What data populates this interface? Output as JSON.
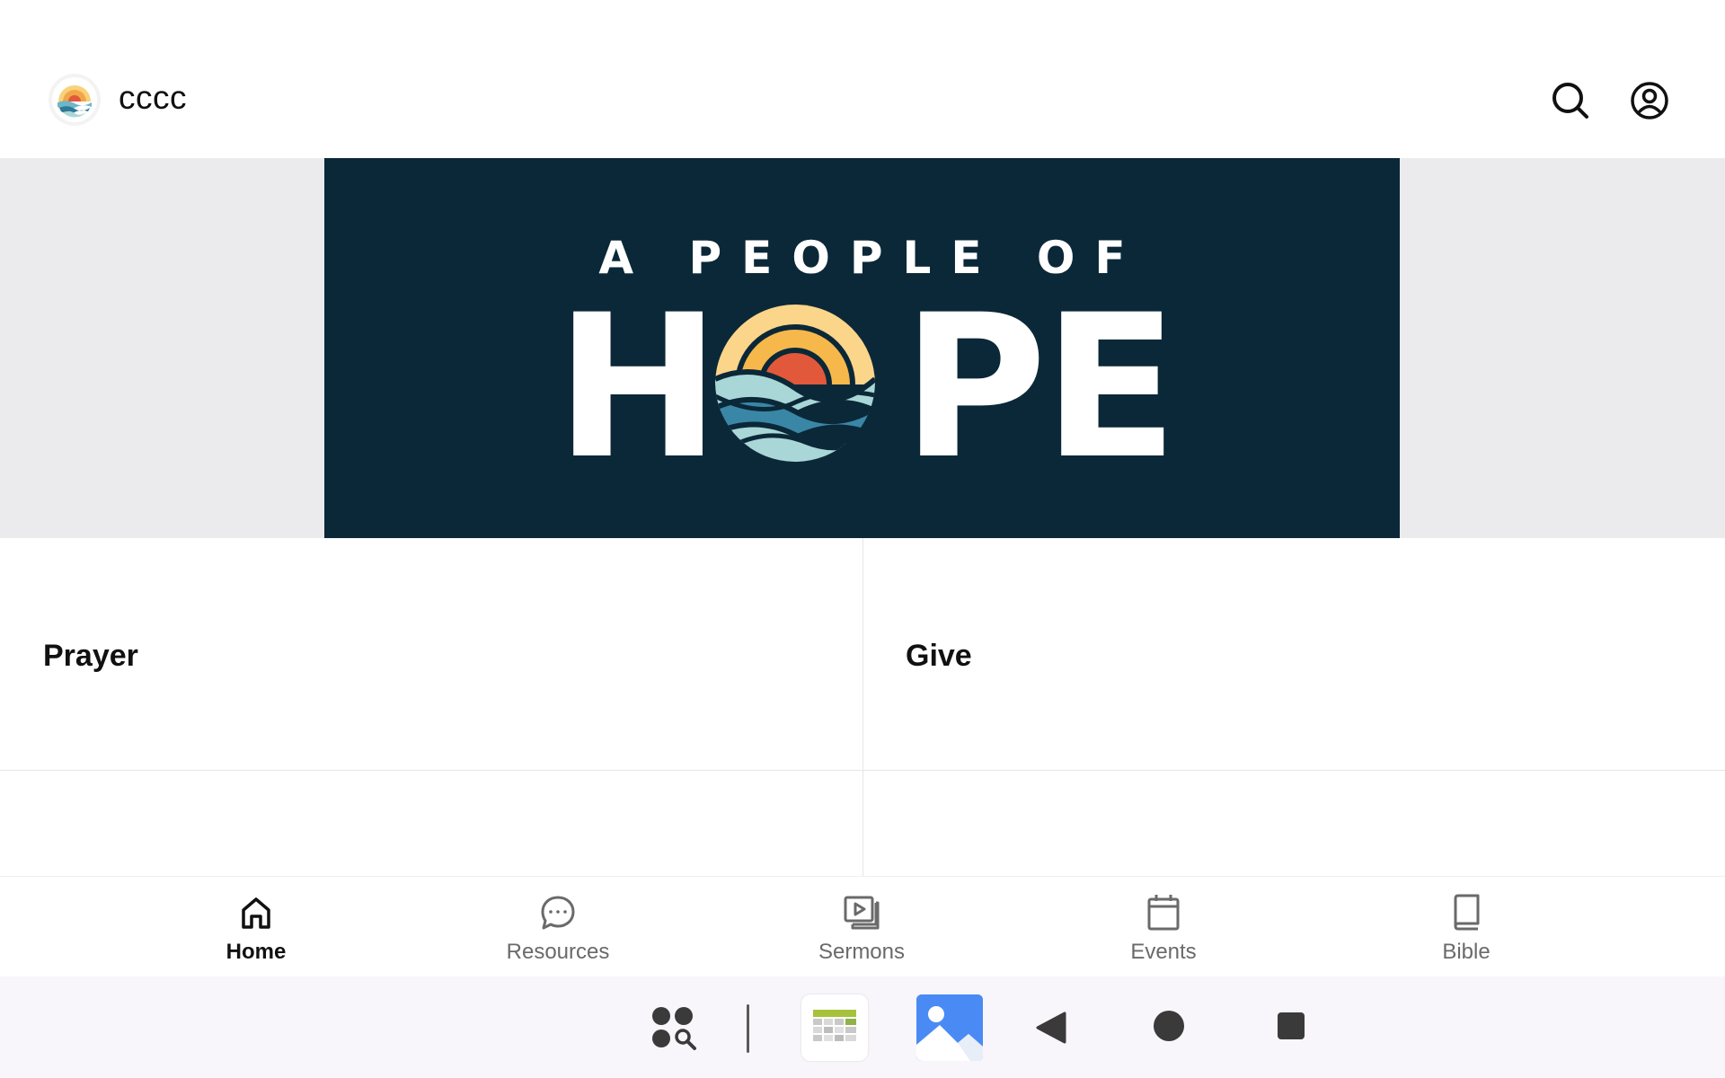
{
  "app": {
    "title": "cccc",
    "logo_icon": "sunset-waves-logo-icon"
  },
  "top_actions": {
    "search_icon": "search-icon",
    "account_icon": "account-circle-icon"
  },
  "hero": {
    "line1": "A PEOPLE OF",
    "word_letters": [
      "H",
      "P",
      "E"
    ],
    "o_icon": "sunset-waves-emblem",
    "background": "#0b2838"
  },
  "tiles": [
    {
      "label": "Prayer"
    },
    {
      "label": "Give"
    }
  ],
  "bottom_nav": {
    "items": [
      {
        "label": "Home",
        "icon": "home-icon",
        "active": true
      },
      {
        "label": "Resources",
        "icon": "chat-bubble-icon",
        "active": false
      },
      {
        "label": "Sermons",
        "icon": "video-library-icon",
        "active": false
      },
      {
        "label": "Events",
        "icon": "calendar-icon",
        "active": false
      },
      {
        "label": "Bible",
        "icon": "book-icon",
        "active": false
      }
    ]
  },
  "system_bar": {
    "items": [
      "app-drawer-icon",
      "calendar-app-icon",
      "gallery-app-icon",
      "back-icon",
      "home-circle-icon",
      "recents-icon"
    ]
  },
  "colors": {
    "hero_bg": "#0b2838",
    "sun_yellow": "#f6c15a",
    "sun_orange": "#e2583a",
    "wave_light": "#a9d6d6",
    "wave_teal": "#3a86a6",
    "wave_dark": "#1d5f82"
  }
}
